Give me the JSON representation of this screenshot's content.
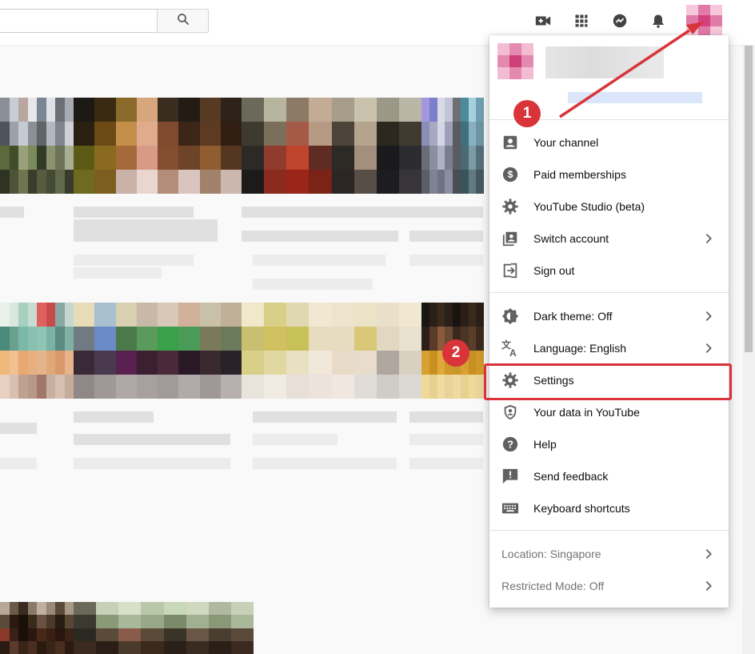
{
  "header": {
    "search_placeholder": "",
    "icons": [
      "search-icon",
      "create-video-icon",
      "apps-grid-icon",
      "messages-icon",
      "notifications-bell-icon"
    ]
  },
  "account_menu": {
    "items": [
      {
        "label": "Your channel",
        "icon": "person-icon"
      },
      {
        "label": "Paid memberships",
        "icon": "dollar-icon"
      },
      {
        "label": "YouTube Studio (beta)",
        "icon": "gear-icon"
      },
      {
        "label": "Switch account",
        "icon": "switch-account-icon",
        "chevron": true
      },
      {
        "label": "Sign out",
        "icon": "sign-out-icon"
      },
      {
        "label": "Dark theme: Off",
        "icon": "dark-theme-icon",
        "chevron": true
      },
      {
        "label": "Language: English",
        "icon": "translate-icon",
        "chevron": true
      },
      {
        "label": "Settings",
        "icon": "gear-icon"
      },
      {
        "label": "Your data in YouTube",
        "icon": "shield-person-icon"
      },
      {
        "label": "Help",
        "icon": "help-icon"
      },
      {
        "label": "Send feedback",
        "icon": "feedback-icon"
      },
      {
        "label": "Keyboard shortcuts",
        "icon": "keyboard-icon"
      }
    ],
    "footer": [
      {
        "label": "Location: Singapore",
        "chevron": true
      },
      {
        "label": "Restricted Mode: Off",
        "chevron": true
      }
    ]
  },
  "annotations": {
    "step1": "1",
    "step2": "2",
    "color": "#d8343a"
  },
  "colors": {
    "icon_gray": "#606060",
    "footer_text": "#737373",
    "email_blur": "#dbe6fb"
  }
}
